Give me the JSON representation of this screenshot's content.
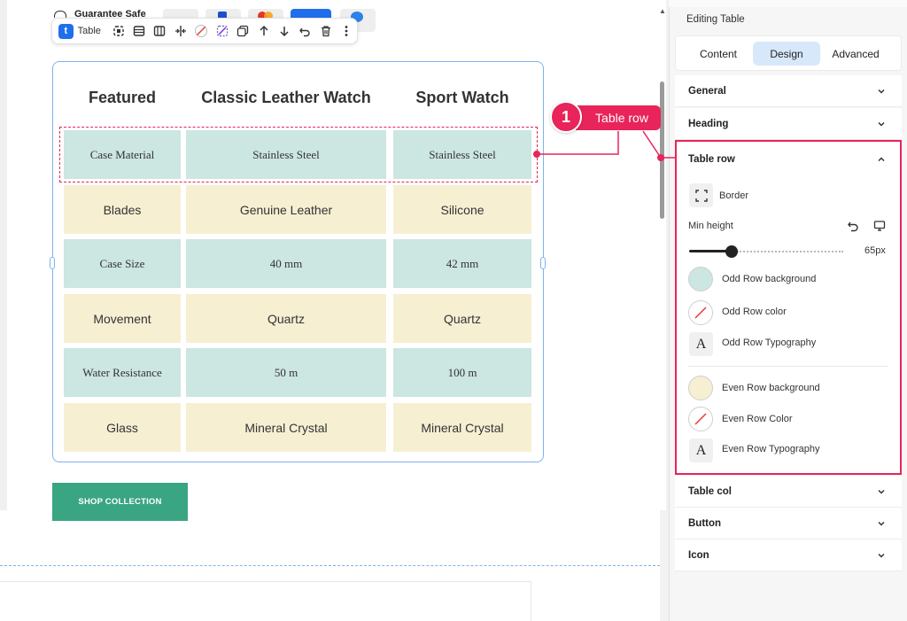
{
  "product_page": {
    "guarantee_text": "Guarantee Safe"
  },
  "toolbar": {
    "widget_label": "Table",
    "badge_letter": "t",
    "icons": [
      "copy-style-icon",
      "rows-icon",
      "columns-icon",
      "split-icon",
      "no-color-icon",
      "magic-icon",
      "duplicate-icon",
      "arrow-up-icon",
      "arrow-down-icon",
      "undo-icon",
      "trash-icon",
      "more-icon"
    ]
  },
  "table": {
    "headers": [
      "Featured",
      "Classic Leather Watch",
      "Sport Watch"
    ],
    "rows": [
      [
        "Case Material",
        "Stainless Steel",
        "Stainless Steel"
      ],
      [
        "Blades",
        "Genuine Leather",
        "Silicone"
      ],
      [
        "Case Size",
        "40 mm",
        "42 mm"
      ],
      [
        "Movement",
        "Quartz",
        "Quartz"
      ],
      [
        "Water Resistance",
        "50 m",
        "100 m"
      ],
      [
        "Glass",
        "Mineral Crystal",
        "Mineral Crystal"
      ]
    ],
    "odd_row_color": "#cce6e1",
    "even_row_color": "#f6efd2"
  },
  "shop_button": {
    "label": "SHOP COLLECTION",
    "color": "#3aa582"
  },
  "annotation": {
    "number": "1",
    "label": "Table row",
    "color": "#e8245a"
  },
  "panel": {
    "title": "Editing Table",
    "tabs": [
      {
        "label": "Content",
        "active": false
      },
      {
        "label": "Design",
        "active": true
      },
      {
        "label": "Advanced",
        "active": false
      }
    ],
    "sections_top": [
      "General",
      "Heading"
    ],
    "table_row": {
      "label": "Table row",
      "border_label": "Border",
      "min_height_label": "Min height",
      "min_height_value": "65px",
      "odd_bg_label": "Odd Row background",
      "odd_color_label": "Odd Row color",
      "odd_typo_label": "Odd Row Typography",
      "even_bg_label": "Even Row background",
      "even_color_label": "Even Row Color",
      "even_typo_label": "Even Row Typography",
      "typo_glyph": "A"
    },
    "sections_bottom": [
      "Table col",
      "Button",
      "Icon"
    ]
  }
}
